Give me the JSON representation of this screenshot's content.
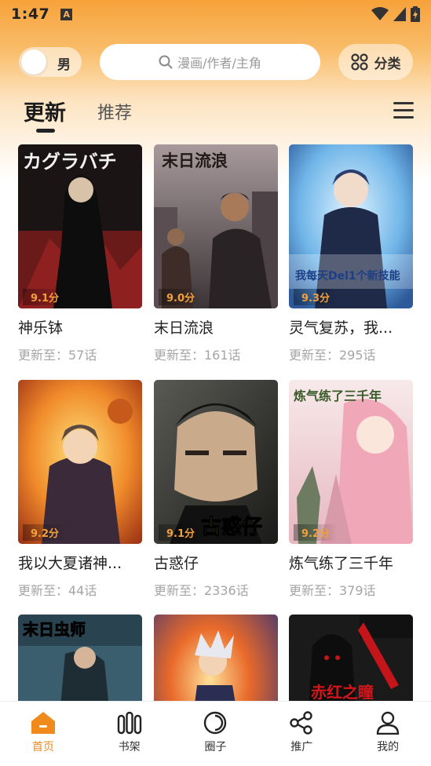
{
  "status": {
    "time": "1:47",
    "notif_letter": "A"
  },
  "header": {
    "gender_label": "男",
    "search_placeholder": "漫画/作者/主角",
    "category_label": "分类"
  },
  "tabs": {
    "update": "更新",
    "recommend": "推荐"
  },
  "comics": [
    {
      "title": "神乐钵",
      "score": "9.1分",
      "update": "更新至：57话"
    },
    {
      "title": "末日流浪",
      "score": "9.0分",
      "update": "更新至：161话"
    },
    {
      "title": "灵气复苏，我...",
      "score": "9.3分",
      "update": "更新至：295话"
    },
    {
      "title": "我以大夏诸神...",
      "score": "9.2分",
      "update": "更新至：44话"
    },
    {
      "title": "古惑仔",
      "score": "9.1分",
      "update": "更新至：2336话"
    },
    {
      "title": "炼气练了三千年",
      "score": "9.2分",
      "update": "更新至：379话"
    },
    {
      "title": "",
      "score": "",
      "update": ""
    },
    {
      "title": "",
      "score": "",
      "update": ""
    },
    {
      "title": "",
      "score": "",
      "update": ""
    }
  ],
  "cover_text": {
    "c1": "カグラバチ",
    "c2": "末日流浪",
    "c3": "我每天Del1个新技能",
    "c5": "古惑仔",
    "c6": "炼气练了三千年",
    "c7": "末日虫师",
    "c9": "赤红之瞳"
  },
  "nav": {
    "home": "首页",
    "shelf": "书架",
    "circle": "圈子",
    "promote": "推广",
    "mine": "我的"
  },
  "colors": {
    "accent": "#f08a1c",
    "score": "#f3a03c"
  }
}
